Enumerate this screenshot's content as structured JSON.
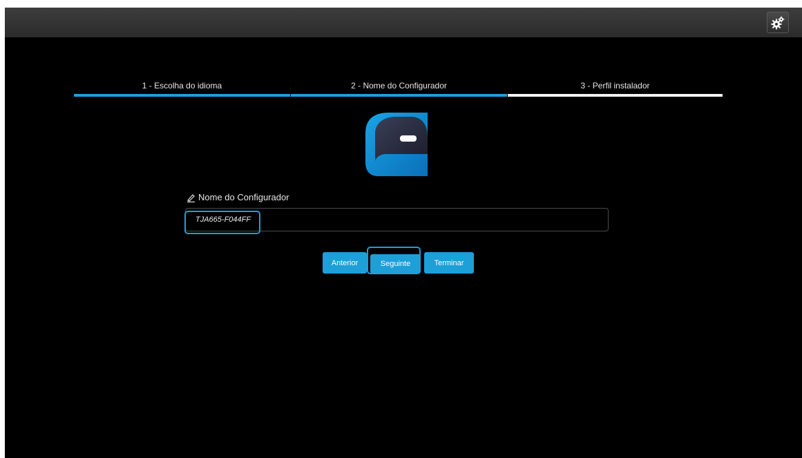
{
  "header": {
    "settings_icon": "gears-icon"
  },
  "wizard": {
    "steps": [
      {
        "label": "1 - Escolha do idioma",
        "state": "done"
      },
      {
        "label": "2 - Nome do Configurador",
        "state": "active"
      },
      {
        "label": "3 - Perfil instalador",
        "state": "pending"
      }
    ]
  },
  "form": {
    "label": "Nome do Configurador",
    "label_icon": "pencil-icon",
    "value": "TJA665-F044FF"
  },
  "buttons": {
    "previous": "Anterior",
    "next": "Seguinte",
    "finish": "Terminar"
  },
  "colors": {
    "accent": "#1d9fd8",
    "background": "#000000",
    "topbar": "#333333"
  }
}
